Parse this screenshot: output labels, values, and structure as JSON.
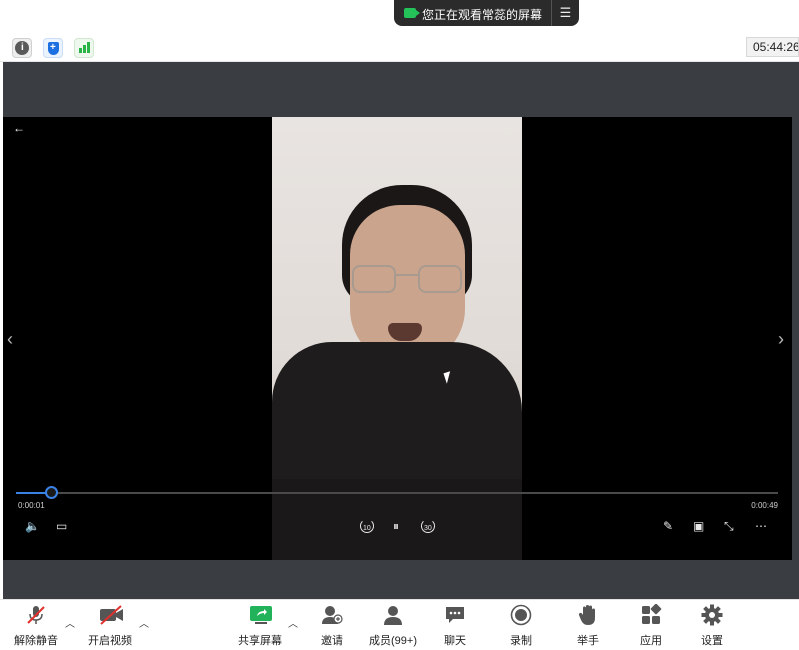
{
  "banner": {
    "text": "您正在观看常蕊的屏幕",
    "menu_icon": "menu-icon"
  },
  "status": {
    "time": "05:44:26"
  },
  "player": {
    "current_time": "0:00:01",
    "duration": "0:00:49",
    "progress_fraction": 0.046,
    "skip_back": "10",
    "skip_forward": "30"
  },
  "toolbar": {
    "unmute": "解除静音",
    "start_video": "开启视频",
    "share_screen": "共享屏幕",
    "invite": "邀请",
    "participants": "成员(99+)",
    "chat": "聊天",
    "record": "录制",
    "raise_hand": "举手",
    "apps": "应用",
    "settings": "设置"
  },
  "colors": {
    "accent": "#3b82e6",
    "banner_bg": "#2b2b2b",
    "share_green": "#23c35a",
    "stage_bg": "#3a3d42"
  }
}
